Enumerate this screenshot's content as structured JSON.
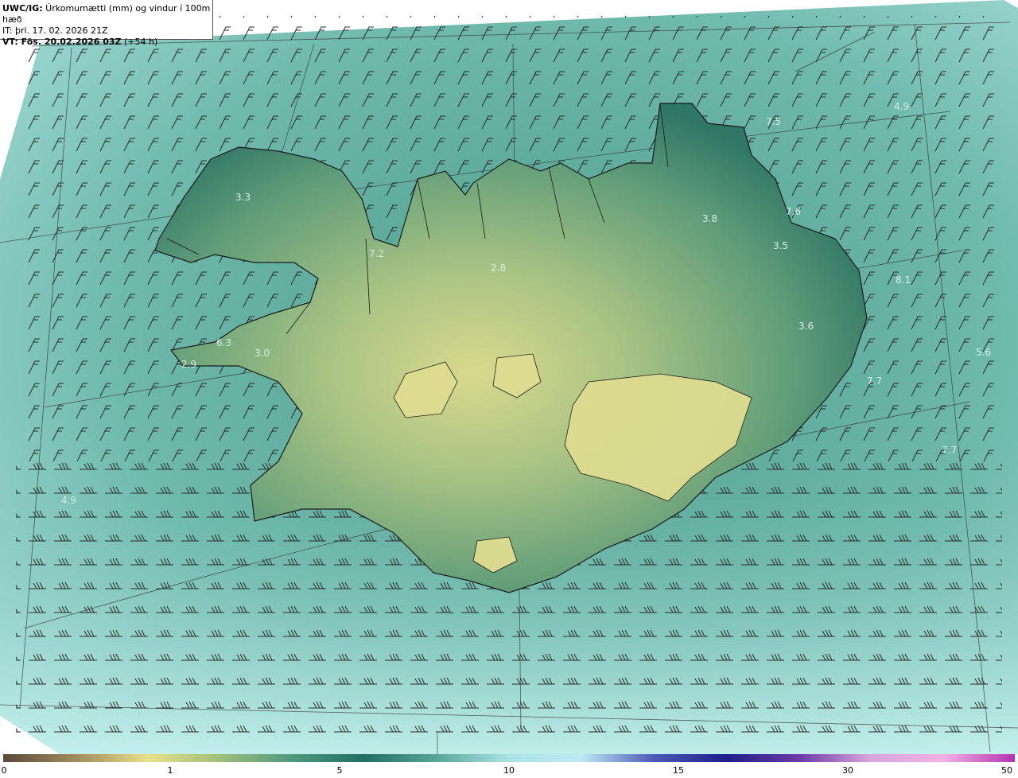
{
  "header": {
    "line1_bold": "UWC/IG:",
    "line1_rest": " Úrkomumætti (mm) og vindur í 100m hæð",
    "line2": "IT: þri. 17. 02. 2026 21Z",
    "line3_bold": "VT: Fös. 20.02.2026 03Z",
    "line3_rest": " (+54 h)"
  },
  "colorbar": {
    "ticks": [
      "0",
      "1",
      "5",
      "10",
      "15",
      "30",
      "50"
    ],
    "colors": [
      "#5b4a3a",
      "#a08a5c",
      "#e8e08a",
      "#9fbf7a",
      "#4e9a7e",
      "#1f6f63",
      "#5aa79a",
      "#a9e4e4",
      "#bfe9f3",
      "#4d5bb8",
      "#1f1f8a",
      "#6a3aa6",
      "#d9a5dd",
      "#f3b2e4",
      "#b433b3"
    ]
  },
  "map": {
    "values": [
      "4.9",
      "3.3",
      "7.2",
      "2.8",
      "3.8",
      "7.5",
      "7.6",
      "3.5",
      "8.1",
      "3.6",
      "5.6",
      "7.7",
      "7.7",
      "6.3",
      "3.0",
      "2.9",
      "4.9"
    ],
    "colors": {
      "ocean": "#7fc7bd",
      "ocean_light": "#b6e6e4",
      "land_low": "#2f7a68",
      "land_mid": "#6da37c",
      "land_high": "#d8d98e",
      "coast": "#1a1a1a",
      "barb": "#2b2b2b"
    }
  }
}
